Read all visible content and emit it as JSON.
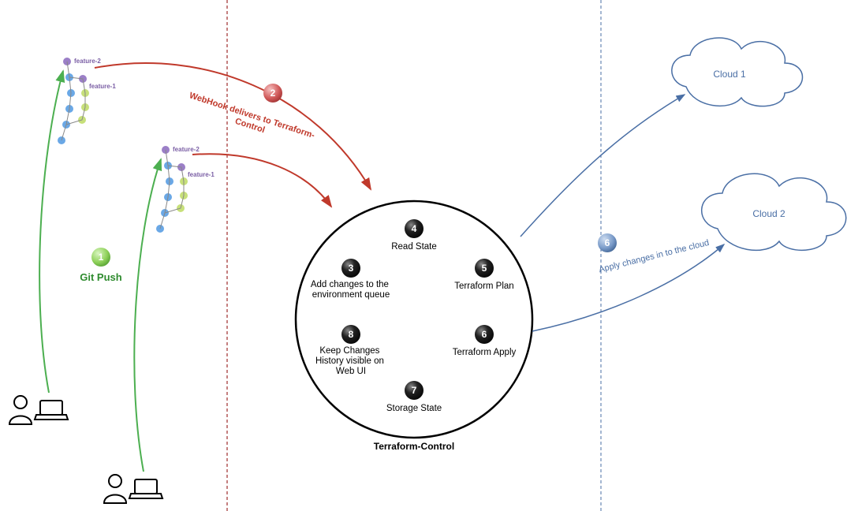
{
  "title": "Terraform-Control",
  "flow_labels": {
    "git_push": "Git Push",
    "webhook_l1": "WebHook delivers to Terraform-",
    "webhook_l2": "Control",
    "apply_cloud": "Apply changes in to the cloud"
  },
  "steps": {
    "s3_l1": "Add changes to the",
    "s3_l2": "environment queue",
    "s4": "Read State",
    "s5": "Terraform Plan",
    "s6": "Terraform Apply",
    "s7": "Storage State",
    "s8_l1": "Keep Changes",
    "s8_l2": "History visible on",
    "s8_l3": "Web UI"
  },
  "badges": {
    "n1": "1",
    "n2": "2",
    "n3": "3",
    "n4": "4",
    "n5": "5",
    "n6": "6",
    "n7": "7",
    "n8": "8",
    "n6b": "6"
  },
  "clouds": {
    "c1": "Cloud 1",
    "c2": "Cloud 2"
  },
  "git": {
    "feature2": "feature-2",
    "feature1": "feature-1"
  }
}
